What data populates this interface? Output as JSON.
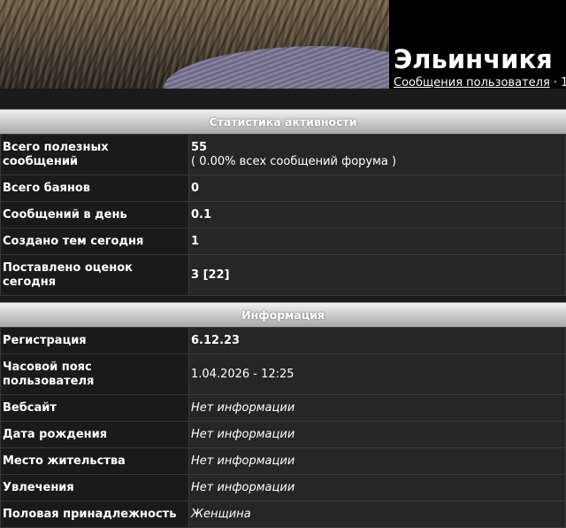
{
  "profile": {
    "username": "Эльинчикя",
    "links_text": "Сообщения пользователя",
    "links_sep": " · 1"
  },
  "activity": {
    "title": "Статистика активности",
    "rows": [
      {
        "label": "Всего полезных сообщений",
        "value": "55",
        "sub": "( 0.00% всех сообщений форума )"
      },
      {
        "label": "Всего баянов",
        "value": "0"
      },
      {
        "label": "Сообщений в день",
        "value": "0.1"
      },
      {
        "label": "Создано тем сегодня",
        "value": "1"
      },
      {
        "label": "Поставлено оценок сегодня",
        "value": "3 [22]"
      }
    ]
  },
  "info": {
    "title": "Информация",
    "rows": [
      {
        "label": "Регистрация",
        "value": "6.12.23"
      },
      {
        "label": "Часовой пояс пользователя",
        "value": "1.04.2026 - 12:25"
      },
      {
        "label": "Вебсайт",
        "value": "Нет информации"
      },
      {
        "label": "Дата рождения",
        "value": "Нет информации"
      },
      {
        "label": "Место жительства",
        "value": "Нет информации"
      },
      {
        "label": "Увлечения",
        "value": "Нет информации"
      },
      {
        "label": "Половая принадлежность",
        "value": "Женщина"
      }
    ]
  }
}
